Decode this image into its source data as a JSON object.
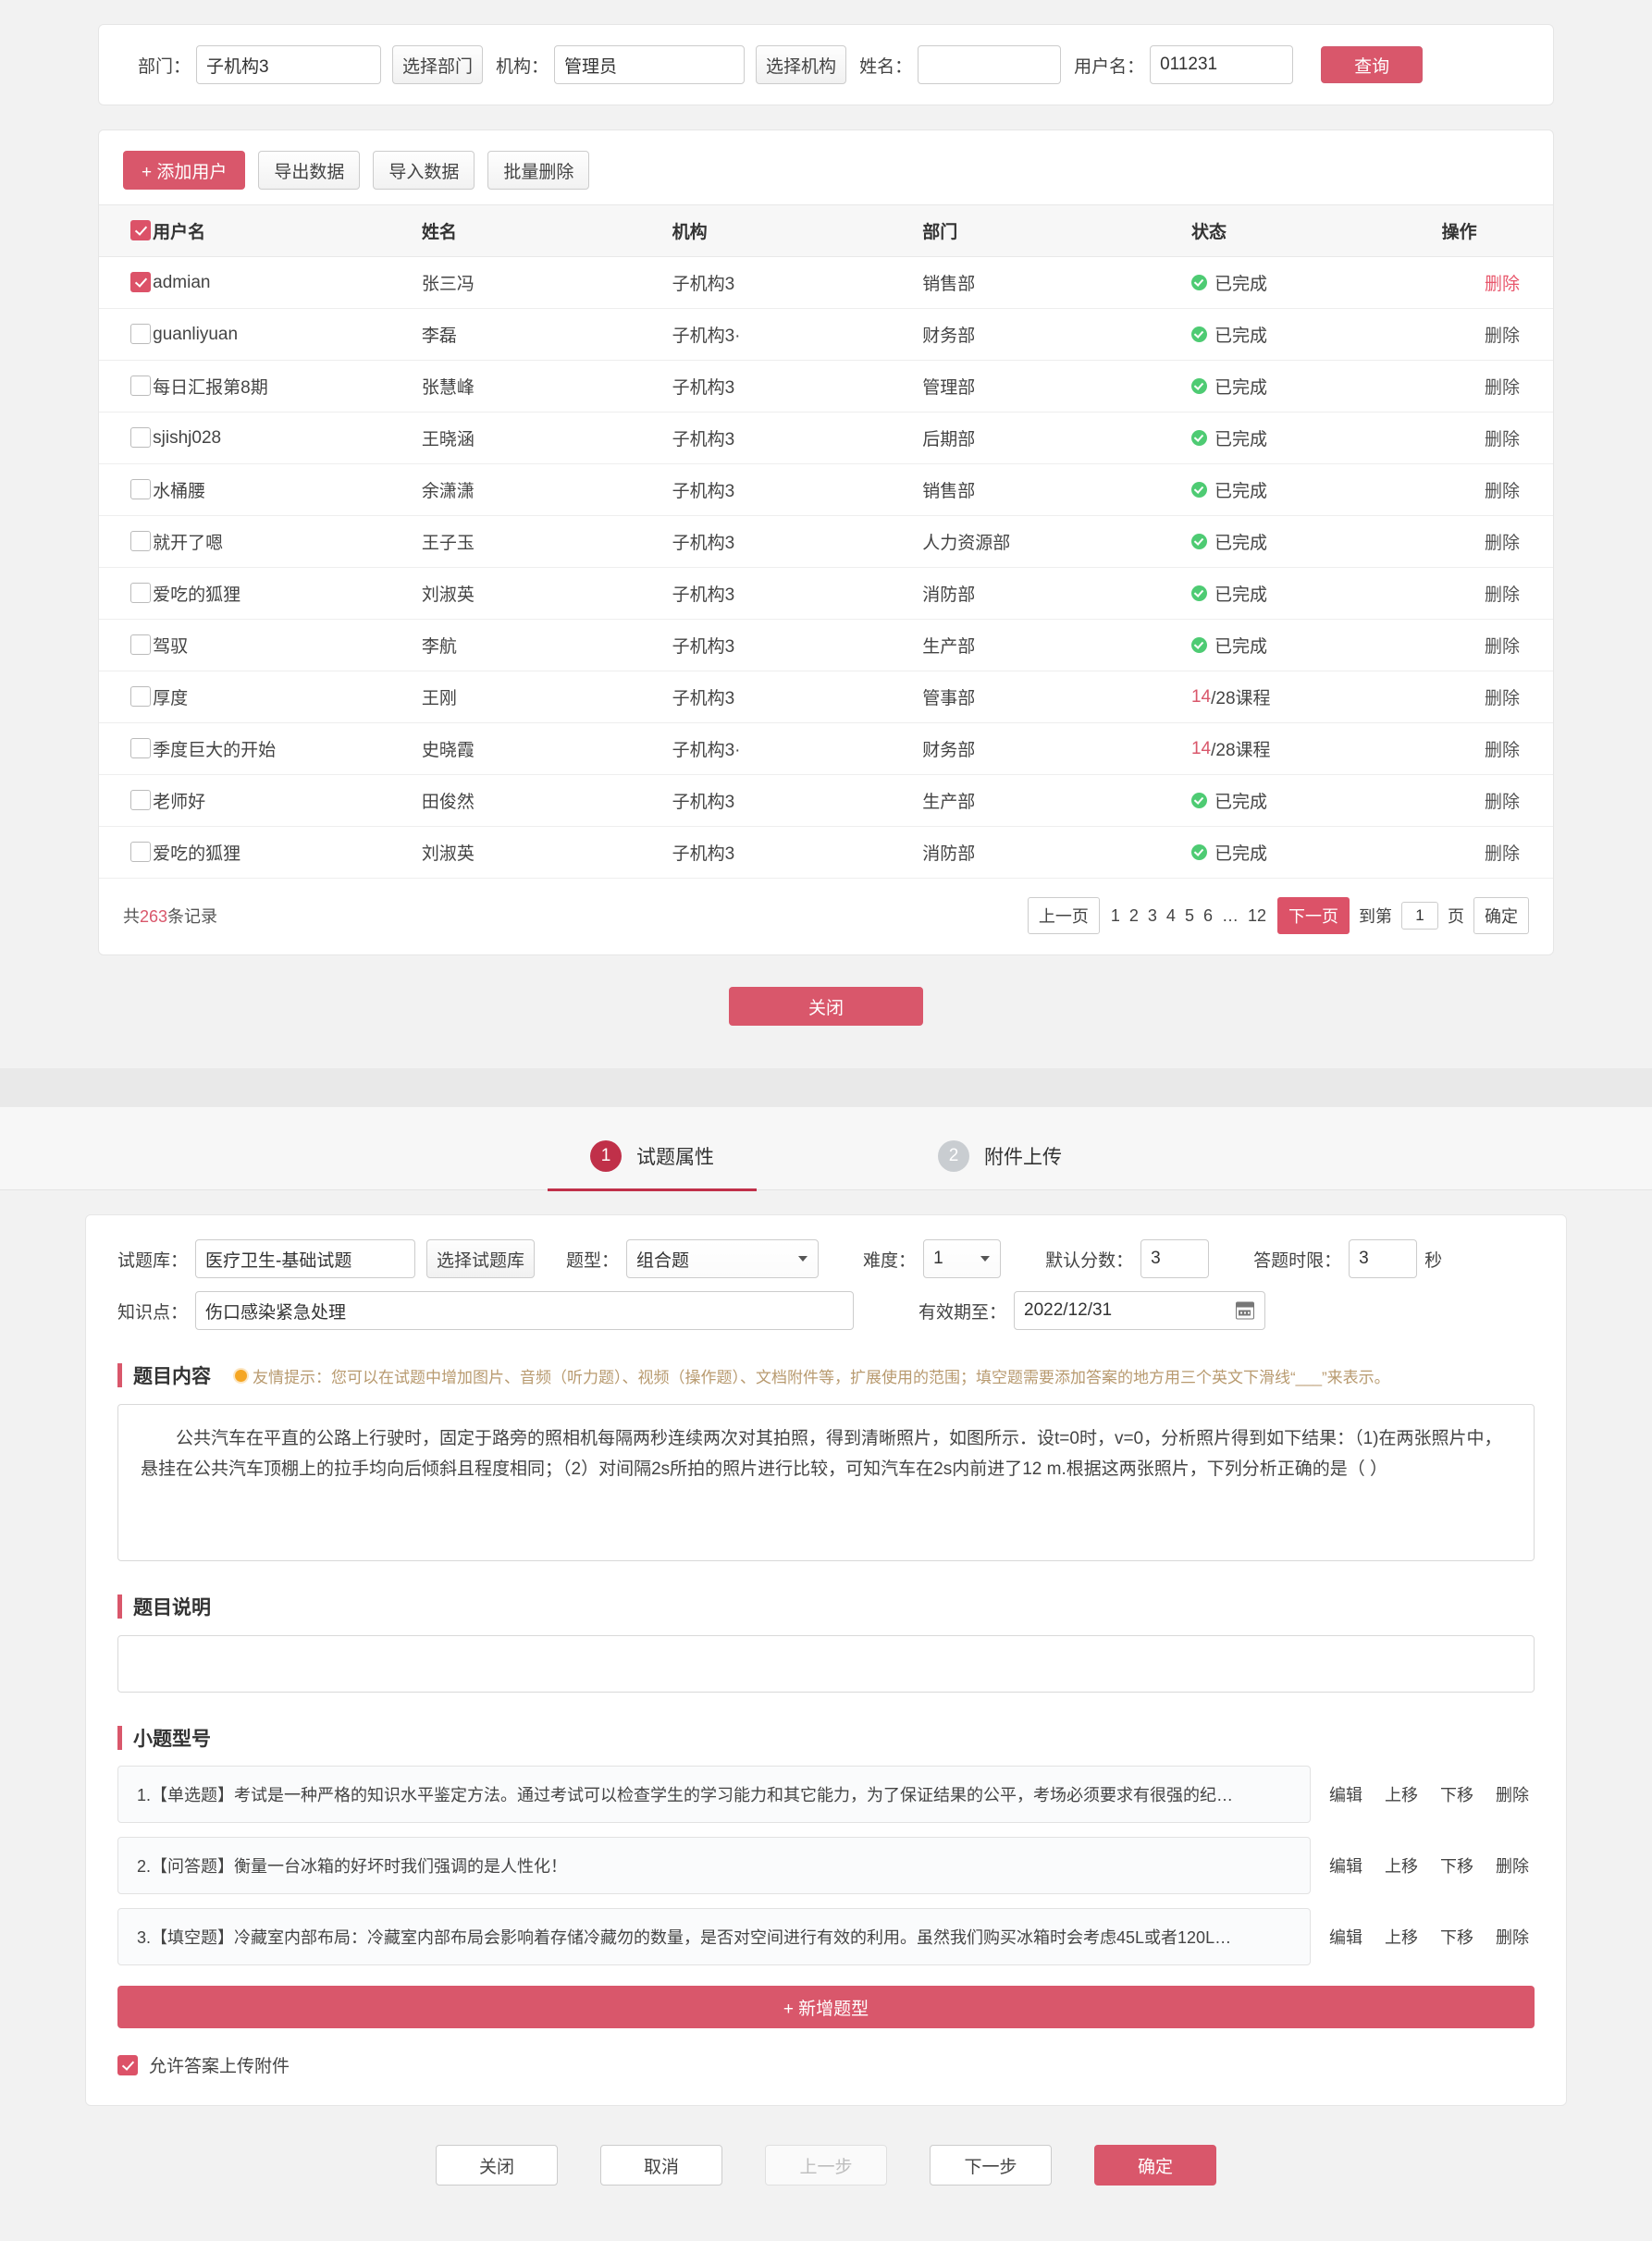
{
  "user_picker": {
    "search": {
      "dept_label": "部门：",
      "dept_value": "子机构3",
      "dept_button": "选择部门",
      "org_label": "机构：",
      "org_value": "管理员",
      "org_button": "选择机构",
      "name_label": "姓名：",
      "name_value": "",
      "username_label": "用户名：",
      "username_value": "011231",
      "query_button": "查询"
    },
    "toolbar": {
      "add_user": "+ 添加用户",
      "export": "导出数据",
      "import": "导入数据",
      "batch_delete": "批量删除"
    },
    "table": {
      "headers": [
        "用户名",
        "姓名",
        "机构",
        "部门",
        "状态",
        "操作"
      ],
      "rows": [
        {
          "checked": true,
          "username": "admian",
          "name": "张三冯",
          "org": "子机构3",
          "dept": "销售部",
          "status": "已完成",
          "status_type": "done",
          "action": "删除",
          "action_active": true
        },
        {
          "checked": false,
          "username": "guanliyuan",
          "name": "李磊",
          "org": "子机构3·",
          "dept": "财务部",
          "status": "已完成",
          "status_type": "done",
          "action": "删除",
          "action_active": false
        },
        {
          "checked": false,
          "username": "每日汇报第8期",
          "name": "张慧峰",
          "org": "子机构3",
          "dept": "管理部",
          "status": "已完成",
          "status_type": "done",
          "action": "删除",
          "action_active": false
        },
        {
          "checked": false,
          "username": "sjishj028",
          "name": "王晓涵",
          "org": "子机构3",
          "dept": "后期部",
          "status": "已完成",
          "status_type": "done",
          "action": "删除",
          "action_active": false
        },
        {
          "checked": false,
          "username": "水桶腰",
          "name": "余潇潇",
          "org": "子机构3",
          "dept": "销售部",
          "status": "已完成",
          "status_type": "done",
          "action": "删除",
          "action_active": false
        },
        {
          "checked": false,
          "username": "就开了嗯",
          "name": "王子玉",
          "org": "子机构3",
          "dept": "人力资源部",
          "status": "已完成",
          "status_type": "done",
          "action": "删除",
          "action_active": false
        },
        {
          "checked": false,
          "username": "爱吃的狐狸",
          "name": "刘淑英",
          "org": "子机构3",
          "dept": "消防部",
          "status": "已完成",
          "status_type": "done",
          "action": "删除",
          "action_active": false
        },
        {
          "checked": false,
          "username": "驾驭",
          "name": "李航",
          "org": "子机构3",
          "dept": "生产部",
          "status": "已完成",
          "status_type": "done",
          "action": "删除",
          "action_active": false
        },
        {
          "checked": false,
          "username": "厚度",
          "name": "王刚",
          "org": "子机构3",
          "dept": "管事部",
          "status_num": "14",
          "status_rest": "/28课程",
          "status_type": "progress",
          "action": "删除",
          "action_active": false
        },
        {
          "checked": false,
          "username": "季度巨大的开始",
          "name": "史晓霞",
          "org": "子机构3·",
          "dept": "财务部",
          "status_num": "14",
          "status_rest": "/28课程",
          "status_type": "progress",
          "action": "删除",
          "action_active": false
        },
        {
          "checked": false,
          "username": "老师好",
          "name": "田俊然",
          "org": "子机构3",
          "dept": "生产部",
          "status": "已完成",
          "status_type": "done",
          "action": "删除",
          "action_active": false
        },
        {
          "checked": false,
          "username": "爱吃的狐狸",
          "name": "刘淑英",
          "org": "子机构3",
          "dept": "消防部",
          "status": "已完成",
          "status_type": "done",
          "action": "删除",
          "action_active": false
        }
      ]
    },
    "pagination": {
      "total_prefix": "共",
      "total_count": "263",
      "total_suffix": "条记录",
      "prev": "上一页",
      "pages": [
        "1",
        "2",
        "3",
        "4",
        "5",
        "6",
        "…",
        "12"
      ],
      "next": "下一页",
      "goto_prefix": "到第",
      "goto_value": "1",
      "goto_suffix": "页",
      "confirm": "确定"
    },
    "close_button": "关闭"
  },
  "question_editor": {
    "steps": [
      {
        "num": "1",
        "label": "试题属性",
        "active": true
      },
      {
        "num": "2",
        "label": "附件上传",
        "active": false
      }
    ],
    "form": {
      "bank_label": "试题库：",
      "bank_value": "医疗卫生-基础试题",
      "bank_button": "选择试题库",
      "type_label": "题型：",
      "type_value": "组合题",
      "difficulty_label": "难度：",
      "difficulty_value": "1",
      "score_label": "默认分数：",
      "score_value": "3",
      "timelimit_label": "答题时限：",
      "timelimit_value": "3",
      "timelimit_unit": "秒",
      "knowledge_label": "知识点：",
      "knowledge_value": "伤口感染紧急处理",
      "valid_label": "有效期至：",
      "valid_value": "2022/12/31"
    },
    "content": {
      "title": "题目内容",
      "tip": "友情提示：您可以在试题中增加图片、音频（听力题）、视频（操作题）、文档附件等，扩展使用的范围；填空题需要添加答案的地方用三个英文下滑线“___”来表示。",
      "body": "公共汽车在平直的公路上行驶时，固定于路旁的照相机每隔两秒连续两次对其拍照，得到清晰照片，如图所示．设t=0时，v=0，分析照片得到如下结果：（1)在两张照片中，悬挂在公共汽车顶棚上的拉手均向后倾斜且程度相同；（2）对间隔2s所拍的照片进行比较，可知汽车在2s内前进了12 m.根据这两张照片，下列分析正确的是（ ）"
    },
    "description": {
      "title": "题目说明",
      "value": ""
    },
    "subtypes": {
      "title": "小题型号",
      "items": [
        {
          "text": "1.【单选题】考试是一种严格的知识水平鉴定方法。通过考试可以检查学生的学习能力和其它能力，为了保证结果的公平，考场必须要求有很强的纪…"
        },
        {
          "text": "2.【问答题】衡量一台冰箱的好坏时我们强调的是人性化！"
        },
        {
          "text": "3.【填空题】冷藏室内部布局：冷藏室内部布局会影响着存储冷藏勿的数量，是否对空间进行有效的利用。虽然我们购买冰箱时会考虑45L或者120L…"
        }
      ],
      "actions": [
        "编辑",
        "上移",
        "下移",
        "删除"
      ],
      "add_button": "+ 新增题型"
    },
    "allow_attachment": {
      "checked": true,
      "label": "允许答案上传附件"
    },
    "footer": {
      "close": "关闭",
      "cancel": "取消",
      "prev": "上一步",
      "next": "下一步",
      "confirm": "确定"
    }
  },
  "colors": {
    "accent": "#d9576b",
    "accent_dark": "#c03049",
    "success": "#4ecb73",
    "tip": "#b89a6f"
  }
}
